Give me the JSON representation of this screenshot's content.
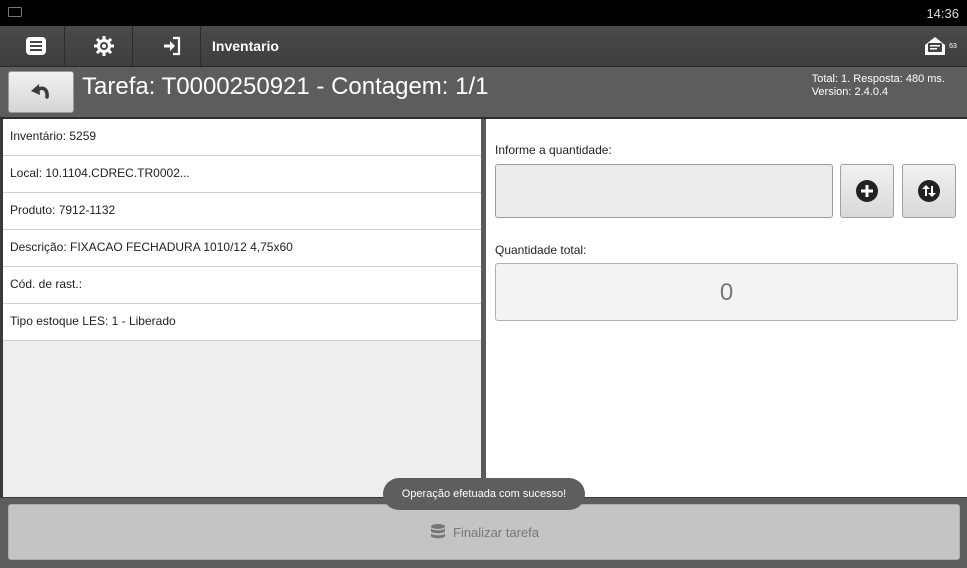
{
  "status_bar": {
    "time": "14:36",
    "keyboard_icon": "keyboard-icon"
  },
  "action_bar": {
    "title": "Inventario",
    "icons": [
      "menu-icon",
      "gear-icon",
      "sign-in-icon",
      "message-icon"
    ],
    "message_count": "63"
  },
  "header": {
    "title": "Tarefa: T0000250921 - Contagem: 1/1",
    "total_line": "Total: 1. Resposta: 480 ms.",
    "version_line": "Version: 2.4.0.4",
    "back_icon": "undo-icon"
  },
  "details": [
    {
      "label": "Inventário: 5259"
    },
    {
      "label": "Local: 10.1104.CDREC.TR0002..."
    },
    {
      "label": "Produto: 7912-1132"
    },
    {
      "label": "Descrição: FIXACAO FECHADURA 1010/12 4,75x60"
    },
    {
      "label": "Cód. de rast.:"
    },
    {
      "label": "Tipo estoque LES: 1 - Liberado"
    }
  ],
  "quantity": {
    "label": "Informe a quantidade:",
    "value": "",
    "add_icon": "plus-circle-icon",
    "swap_icon": "swap-circle-icon"
  },
  "total": {
    "label": "Quantidade total:",
    "value": "0"
  },
  "footer": {
    "finish_label": "Finalizar tarefa",
    "finish_icon": "database-icon"
  },
  "toast": {
    "message": "Operação efetuada com sucesso!"
  }
}
